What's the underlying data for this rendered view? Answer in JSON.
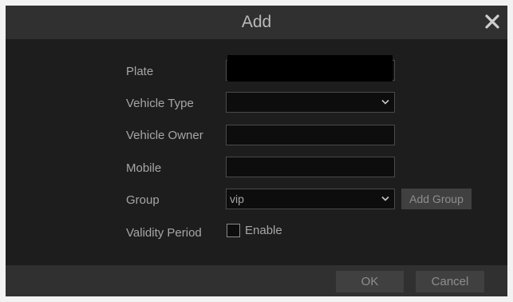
{
  "dialog": {
    "title": "Add",
    "close_icon": "close-icon"
  },
  "form": {
    "plate": {
      "label": "Plate",
      "value": ""
    },
    "vehicle_type": {
      "label": "Vehicle Type",
      "value": ""
    },
    "vehicle_owner": {
      "label": "Vehicle Owner",
      "value": ""
    },
    "mobile": {
      "label": "Mobile",
      "value": ""
    },
    "group": {
      "label": "Group",
      "value": "vip",
      "add_button": "Add Group"
    },
    "validity_period": {
      "label": "Validity Period",
      "checkbox_label": "Enable",
      "checked": false
    }
  },
  "footer": {
    "ok_label": "OK",
    "cancel_label": "Cancel"
  },
  "colors": {
    "dialog_bg": "#1d1d1d",
    "bar_bg": "#303030",
    "text": "#a6a6a6",
    "button_bg": "#404040"
  }
}
